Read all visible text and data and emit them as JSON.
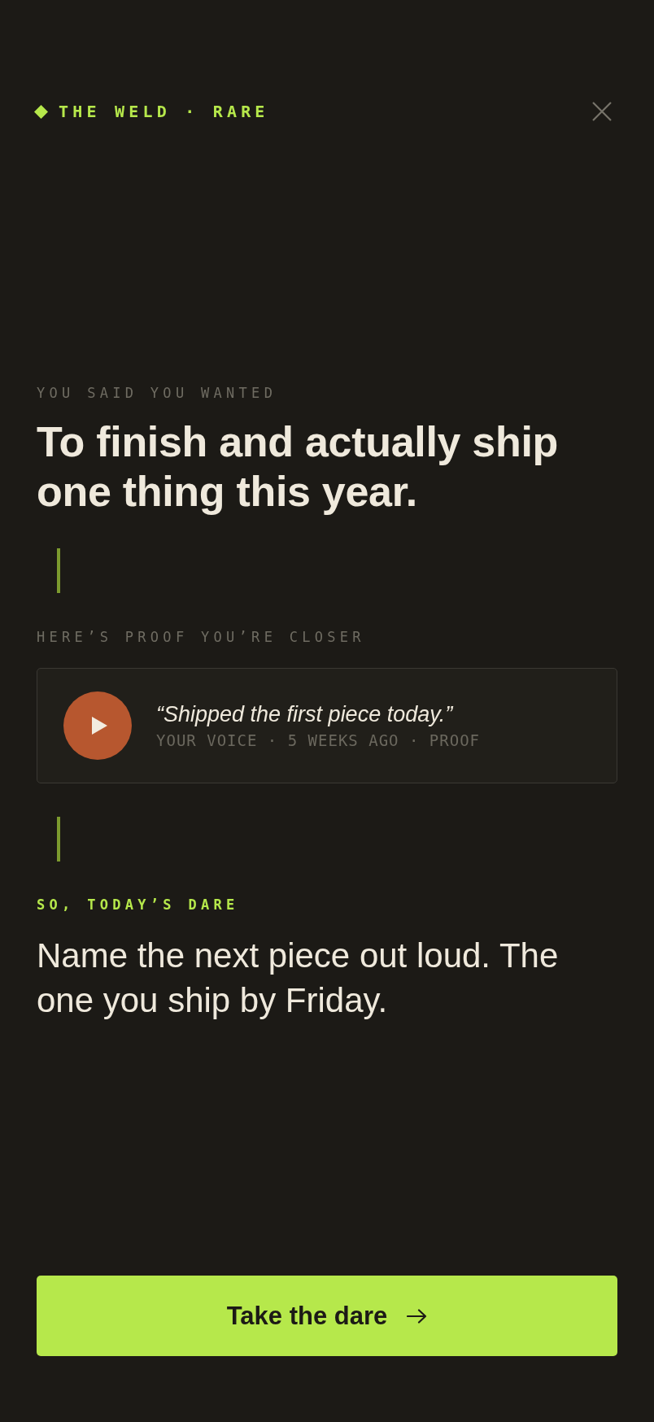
{
  "header": {
    "brand": "THE WELD · RARE"
  },
  "intro": {
    "eyebrow": "YOU SAID YOU WANTED",
    "goal": "To finish and actually ship one thing this year."
  },
  "proof": {
    "eyebrow": "HERE’S PROOF YOU’RE CLOSER",
    "quote": "“Shipped the first piece today.”",
    "meta": "YOUR VOICE · 5 WEEKS AGO · PROOF"
  },
  "dare": {
    "eyebrow": "SO, TODAY’S DARE",
    "text": "Name the next piece out loud. The one you ship by Friday."
  },
  "action": {
    "label": "Take the dare"
  }
}
